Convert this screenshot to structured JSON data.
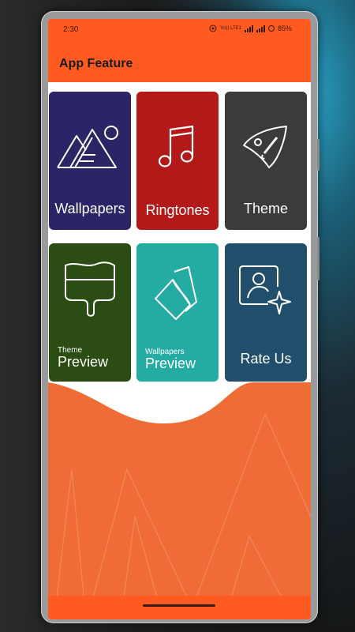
{
  "status_bar": {
    "time": "2:30",
    "network": "Vo)) LTE1",
    "battery": "85%"
  },
  "app_bar": {
    "title": "App Feature"
  },
  "colors": {
    "appbar": "#ff5a1f",
    "wallpapers": "#2b2466",
    "ringtones": "#b41919",
    "theme": "#3b3b3b",
    "theme_preview": "#2b4d14",
    "wallpapers_preview": "#25aca2",
    "rate_us": "#204e6b",
    "bottom": "#ef6c36"
  },
  "features": [
    {
      "label": "Wallpapers",
      "icon": "mountains-icon"
    },
    {
      "label": "Ringtones",
      "icon": "music-note-icon"
    },
    {
      "label": "Theme",
      "icon": "paint-palette-icon"
    },
    {
      "sub": "Theme",
      "label": "Preview",
      "icon": "paint-bucket-icon"
    },
    {
      "sub": "Wallpapers",
      "label": "Preview",
      "icon": "wallpaper-cards-icon"
    },
    {
      "label": "Rate Us",
      "icon": "user-star-icon"
    }
  ]
}
